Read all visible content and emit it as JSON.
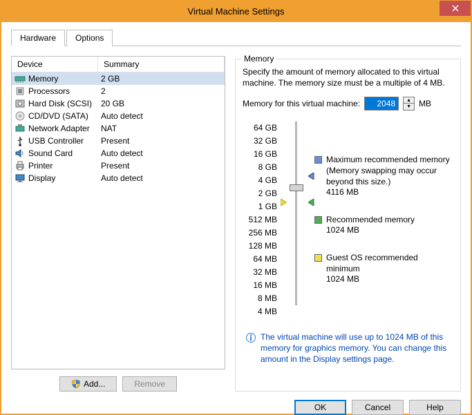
{
  "window": {
    "title": "Virtual Machine Settings"
  },
  "tabs": {
    "hardware": "Hardware",
    "options": "Options"
  },
  "table": {
    "headers": {
      "device": "Device",
      "summary": "Summary"
    },
    "rows": [
      {
        "device": "Memory",
        "summary": "2 GB",
        "selected": true,
        "icon": "memory"
      },
      {
        "device": "Processors",
        "summary": "2",
        "icon": "cpu"
      },
      {
        "device": "Hard Disk (SCSI)",
        "summary": "20 GB",
        "icon": "hdd"
      },
      {
        "device": "CD/DVD (SATA)",
        "summary": "Auto detect",
        "icon": "cd"
      },
      {
        "device": "Network Adapter",
        "summary": "NAT",
        "icon": "nic"
      },
      {
        "device": "USB Controller",
        "summary": "Present",
        "icon": "usb"
      },
      {
        "device": "Sound Card",
        "summary": "Auto detect",
        "icon": "sound"
      },
      {
        "device": "Printer",
        "summary": "Present",
        "icon": "printer"
      },
      {
        "device": "Display",
        "summary": "Auto detect",
        "icon": "display"
      }
    ]
  },
  "buttons": {
    "add": "Add...",
    "remove": "Remove",
    "ok": "OK",
    "cancel": "Cancel",
    "help": "Help"
  },
  "memory": {
    "group_title": "Memory",
    "desc": "Specify the amount of memory allocated to this virtual machine. The memory size must be a multiple of 4 MB.",
    "input_label": "Memory for this virtual machine:",
    "value": "2048",
    "unit": "MB",
    "ticks": [
      "64 GB",
      "32 GB",
      "16 GB",
      "8 GB",
      "4 GB",
      "2 GB",
      "1 GB",
      "512 MB",
      "256 MB",
      "128 MB",
      "64 MB",
      "32 MB",
      "16 MB",
      "8 MB",
      "4 MB"
    ],
    "legend": {
      "max": {
        "label": "Maximum recommended memory",
        "note": "(Memory swapping may occur beyond this size.)",
        "value": "4116 MB",
        "color": "#6a8fd8"
      },
      "rec": {
        "label": "Recommended memory",
        "value": "1024 MB",
        "color": "#4caf50"
      },
      "guest": {
        "label": "Guest OS recommended minimum",
        "value": "1024 MB",
        "color": "#f0e050"
      }
    },
    "info": "The virtual machine will use up to 1024 MB of this memory for graphics memory. You can change this amount in the Display settings page."
  }
}
